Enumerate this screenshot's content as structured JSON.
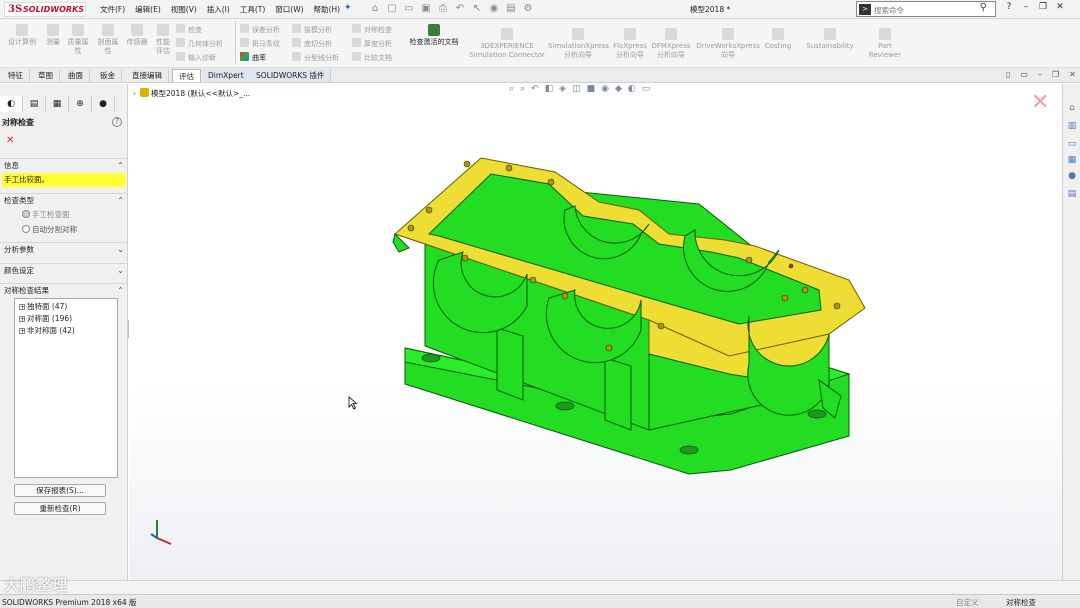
{
  "app": {
    "logo_text": "SOLIDWORKS",
    "menu": [
      "文件(F)",
      "编辑(E)",
      "视图(V)",
      "插入(I)",
      "工具(T)",
      "窗口(W)",
      "帮助(H)"
    ],
    "document_title": "模型2018 *",
    "search_placeholder": "搜索命令",
    "window_controls": [
      "?",
      "–",
      "❐",
      "✕"
    ]
  },
  "command_manager": {
    "big_buttons": [
      {
        "label": "设计算例"
      },
      {
        "label": "测量"
      },
      {
        "label": "质量属\n性"
      },
      {
        "label": "剖面属\n性"
      },
      {
        "label": "传感器"
      },
      {
        "label": "性能\n评估"
      }
    ],
    "small_buttons": [
      {
        "label": "检查"
      },
      {
        "label": "几何体分析"
      },
      {
        "label": "输入诊断"
      },
      {
        "label": "误差分析"
      },
      {
        "label": "斑马条纹"
      },
      {
        "label": "曲率"
      },
      {
        "label": "拔模分析"
      },
      {
        "label": "底切分析"
      },
      {
        "label": "分型线分析"
      },
      {
        "label": "对称检查"
      },
      {
        "label": "厚度分析"
      },
      {
        "label": "比较文档"
      }
    ],
    "check_active_doc": "检查激活的文档",
    "addins": [
      {
        "label": "3DEXPERIENCE\nSimulation Connector"
      },
      {
        "label": "SimulationXpress\n分析向导"
      },
      {
        "label": "FloXpress\n分析向导"
      },
      {
        "label": "DFMXpress\n分析向导"
      },
      {
        "label": "DriveWorksXpress\n向导"
      },
      {
        "label": "Costing"
      },
      {
        "label": "Sustainability"
      },
      {
        "label": "Part\nReviewer"
      }
    ]
  },
  "tabs": [
    "特征",
    "草图",
    "曲面",
    "钣金",
    "直接编辑",
    "评估",
    "DimXpert",
    "SOLIDWORKS 插件"
  ],
  "active_tab": "评估",
  "property_manager": {
    "title": "对称检查",
    "help": "?",
    "sections": {
      "info": {
        "label": "信息",
        "message": "手工比较面。"
      },
      "check_type": {
        "label": "检查类型",
        "options": [
          "手工检查面",
          "自动分割对称"
        ]
      },
      "analysis_params": {
        "label": "分析参数"
      },
      "color_settings": {
        "label": "颜色设定"
      },
      "results": {
        "label": "对称检查结果",
        "items": [
          "独特面 (47)",
          "对称面 (196)",
          "非对称面 (42)"
        ]
      }
    },
    "buttons": {
      "save_report": "保存报表(S)...",
      "recheck": "重新检查(R)"
    }
  },
  "viewport": {
    "feature_path": "模型2018  (默认<<默认>_..."
  },
  "model_colors": {
    "symmetric": "#22dd22",
    "unique": "#eedd33",
    "background": "#ffffff"
  },
  "status": {
    "product": "SOLIDWORKS Premium 2018 x64 版",
    "custom": "自定义",
    "mode": "对称检查"
  },
  "watermark": "大鹏整理"
}
